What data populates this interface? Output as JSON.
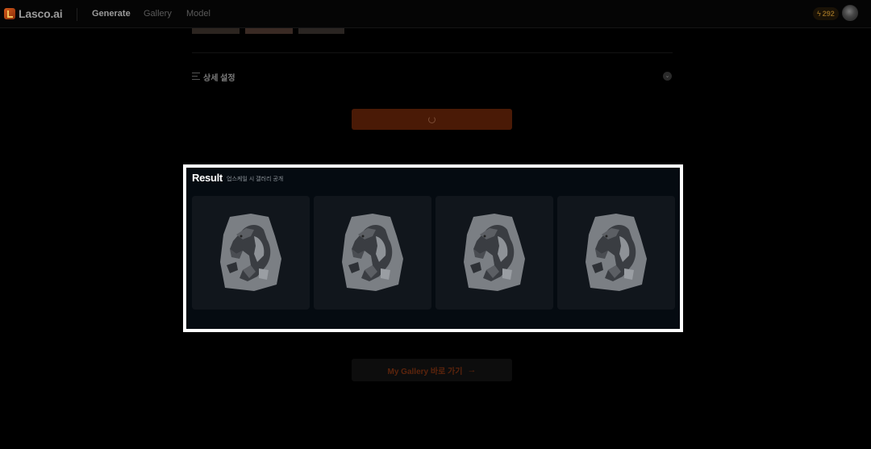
{
  "app": {
    "name": "Lasco.ai"
  },
  "nav": {
    "items": [
      {
        "label": "Generate",
        "active": true
      },
      {
        "label": "Gallery",
        "active": false
      },
      {
        "label": "Model",
        "active": false
      }
    ],
    "credits": "292",
    "credit_icon": "bolt-icon"
  },
  "settings": {
    "label": "상세 설정",
    "icon": "sliders-icon",
    "toggle_icon": "chevron-down-icon"
  },
  "generate": {
    "state": "loading",
    "icon": "spinner-icon"
  },
  "result": {
    "title": "Result",
    "note": "업스케일 시 갤러리 공개",
    "images": [
      {
        "subject": "horse-sculpture"
      },
      {
        "subject": "horse-sculpture"
      },
      {
        "subject": "horse-sculpture"
      },
      {
        "subject": "horse-sculpture"
      }
    ]
  },
  "gallery_link": {
    "label": "My Gallery 바로 가기",
    "icon": "arrow-right-icon"
  },
  "colors": {
    "accent": "#e0561a",
    "background": "#000000",
    "panel": "#050b11",
    "card": "#11161c",
    "highlight": "#ffffff"
  }
}
